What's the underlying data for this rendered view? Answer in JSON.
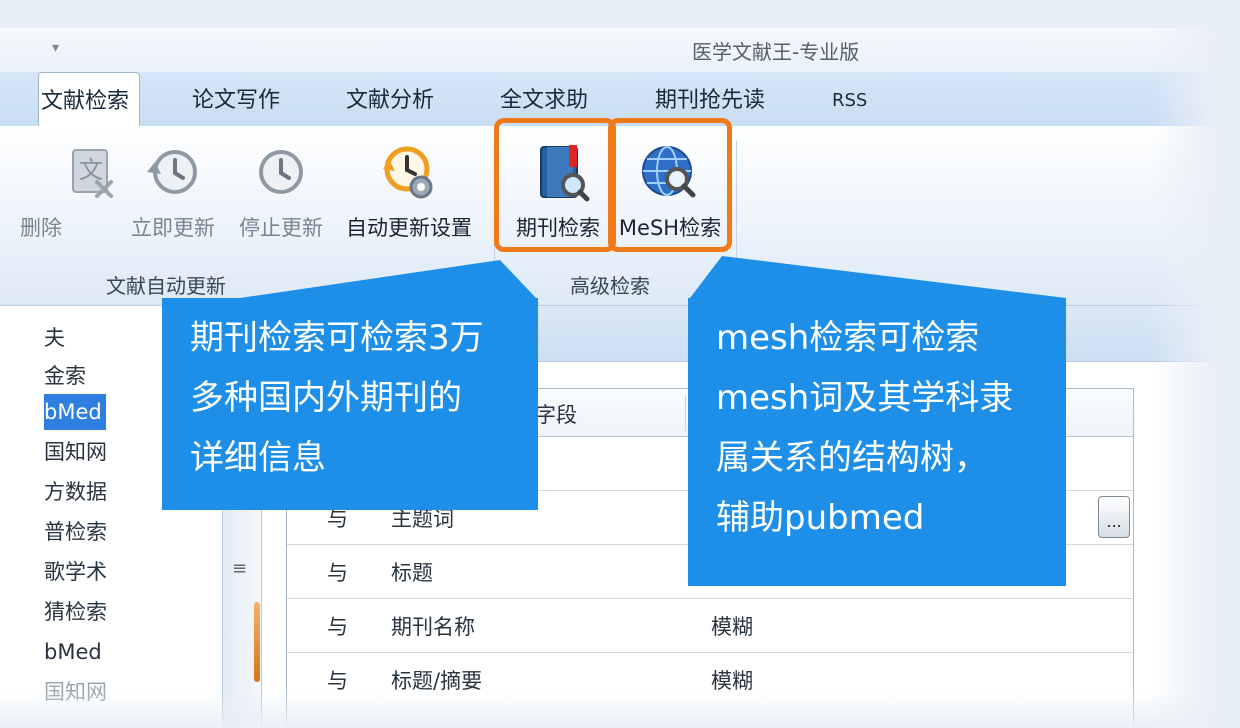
{
  "window": {
    "title": "医学文献王-专业版",
    "quick_access_arrow": "▾"
  },
  "tabs": [
    {
      "label": "文献检索",
      "active": true
    },
    {
      "label": "论文写作"
    },
    {
      "label": "文献分析"
    },
    {
      "label": "全文求助"
    },
    {
      "label": "期刊抢先读"
    },
    {
      "label": "RSS"
    }
  ],
  "ribbon": {
    "buttons": [
      {
        "label": "删除",
        "icon": "delete-doc-icon",
        "enabled": false
      },
      {
        "label": "立即更新",
        "icon": "clock-refresh-icon",
        "enabled": false
      },
      {
        "label": "停止更新",
        "icon": "clock-stop-icon",
        "enabled": false
      },
      {
        "label": "自动更新设置",
        "icon": "clock-gear-icon",
        "enabled": true
      },
      {
        "label": "期刊检索",
        "icon": "journal-search-icon",
        "enabled": true
      },
      {
        "label": "MeSH检索",
        "icon": "globe-search-icon",
        "enabled": true
      }
    ],
    "groups": [
      {
        "label": "文献自动更新"
      },
      {
        "label": "高级检索"
      }
    ],
    "highlight_color": "#f07a1a"
  },
  "leftnav": {
    "items": [
      {
        "label": "夫"
      },
      {
        "label": "金索"
      },
      {
        "label": "bMed",
        "selected": true
      },
      {
        "label": "国知网"
      },
      {
        "label": "方数据"
      },
      {
        "label": "普检索"
      },
      {
        "label": "歌学术"
      },
      {
        "label": "猜检索"
      },
      {
        "label": "bMed"
      },
      {
        "label": "国知网"
      }
    ]
  },
  "grid": {
    "header_field": "字段",
    "rows": [
      {
        "op": "",
        "field": "",
        "mode": ""
      },
      {
        "op": "与",
        "field": "主题词",
        "mode": ""
      },
      {
        "op": "与",
        "field": "标题",
        "mode": ""
      },
      {
        "op": "与",
        "field": "期刊名称",
        "mode": "模糊"
      },
      {
        "op": "与",
        "field": "标题/摘要",
        "mode": "模糊"
      }
    ],
    "ellipsis": "..."
  },
  "callouts": {
    "journal": [
      "期刊检索可检索3万",
      "多种国内外期刊的",
      "详细信息"
    ],
    "mesh": [
      "mesh检索可检索",
      "mesh词及其学科隶",
      "属关系的结构树，",
      "辅助pubmed"
    ],
    "color": "#1e8fe8"
  },
  "splitter_grip": "≡"
}
